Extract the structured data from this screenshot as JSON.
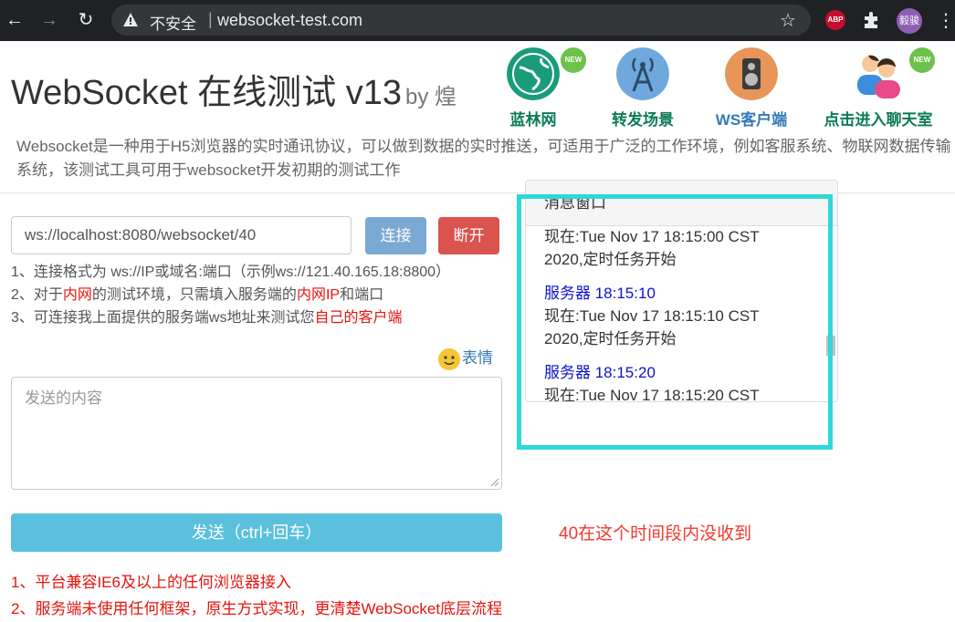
{
  "browser": {
    "insecure_label": "不安全",
    "separator": "|",
    "url": "websocket-test.com",
    "abp_label": "ABP",
    "profile_label": "毅骏"
  },
  "header": {
    "title": "WebSocket 在线测试 v13",
    "byline": "by 煌",
    "nav": [
      {
        "label": "蓝林网",
        "color": "#0b7a57",
        "icon": "globe-icon",
        "badge": "NEW"
      },
      {
        "label": "转发场景",
        "color": "#0b7a57",
        "icon": "antenna-icon"
      },
      {
        "label": "WS客户端",
        "color": "#337ab7",
        "icon": "speaker-icon"
      },
      {
        "label": "点击进入聊天室",
        "color": "#0b7a57",
        "icon": "chat-people-icon",
        "badge": "NEW"
      }
    ],
    "description": "Websocket是一种用于H5浏览器的实时通讯协议，可以做到数据的实时推送，可适用于广泛的工作环境，例如客服系统、物联网数据传输系统，该测试工具可用于websocket开发初期的测试工作"
  },
  "connection": {
    "address": "ws://localhost:8080/websocket/40",
    "connect_label": "连接",
    "disconnect_label": "断开"
  },
  "tips": {
    "line1": "1、连接格式为 ws://IP或域名:端口（示例ws://121.40.165.18:8800）",
    "line2_a": "2、对于",
    "line2_b": "内网",
    "line2_c": "的测试环境，只需填入服务端的",
    "line2_d": "内网IP",
    "line2_e": "和端口",
    "line3_a": "3、可连接我上面提供的服务端ws地址来测试您",
    "line3_b": "自己的客户端"
  },
  "emoji_label": "表情",
  "send": {
    "placeholder": "发送的内容",
    "button_label": "发送（ctrl+回车）"
  },
  "notices": [
    "1、平台兼容IE6及以上的任何浏览器接入",
    "2、服务端未使用任何框架，原生方式实现，更清楚WebSocket底层流程"
  ],
  "message_window": {
    "title": "消息窗口",
    "messages": [
      {
        "text_1": "现在:Tue Nov 17 18:15:00 CST",
        "text_2": "2020,定时任务开始"
      },
      {
        "from": "服务器 18:15:10",
        "text_1": "现在:Tue Nov 17 18:15:10 CST",
        "text_2": "2020,定时任务开始"
      },
      {
        "from": "服务器 18:15:20",
        "text_1": "现在:Tue Nov 17 18:15:20 CST"
      }
    ]
  },
  "annotation": "40在这个时间段内没收到",
  "colors": {
    "highlight": "#2fd7d9",
    "annotation": "#f23a2e"
  }
}
